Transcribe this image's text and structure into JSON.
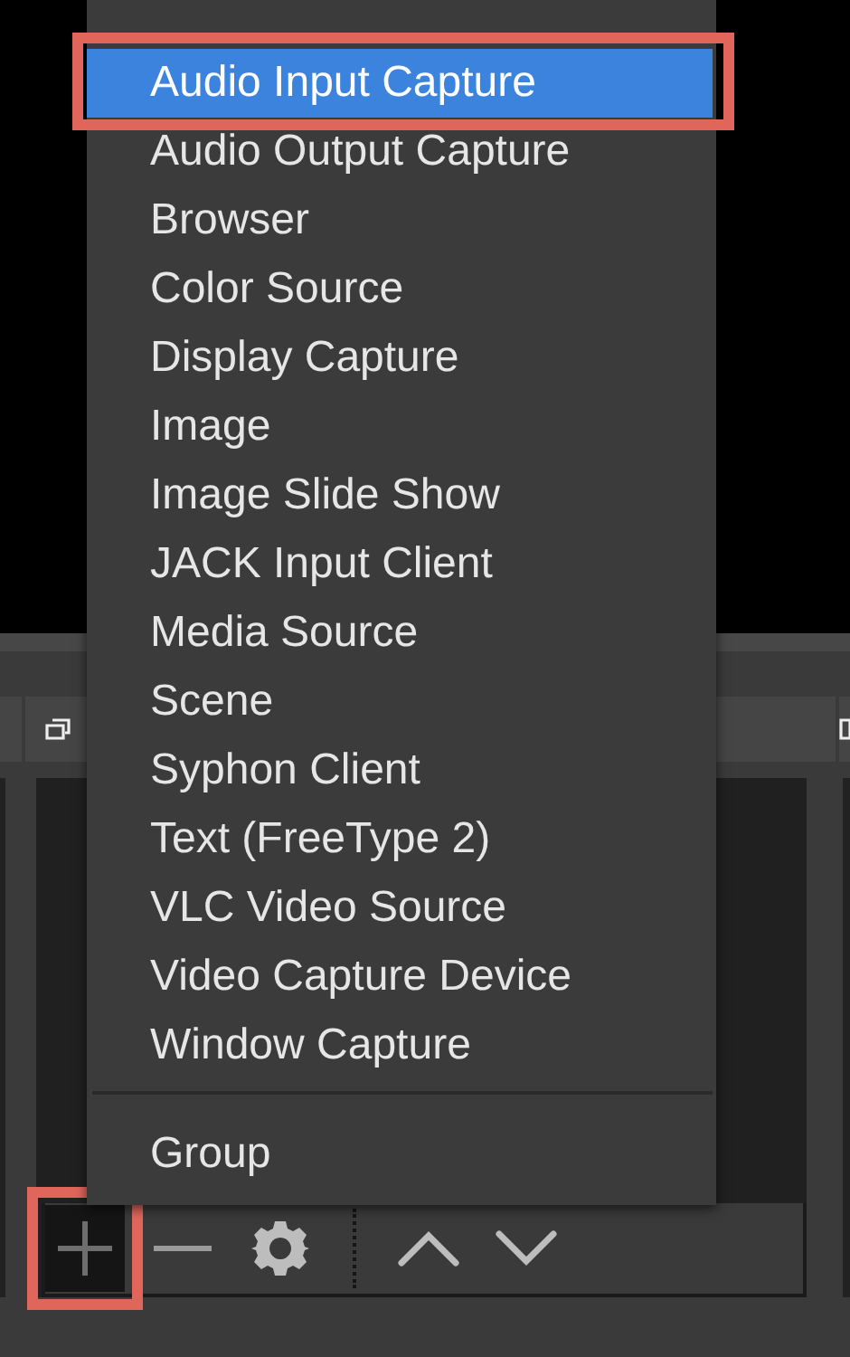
{
  "menu": {
    "items": [
      {
        "label": "Audio Input Capture",
        "selected": true,
        "outlined": true
      },
      {
        "label": "Audio Output Capture",
        "selected": false,
        "outlined": false
      },
      {
        "label": "Browser",
        "selected": false,
        "outlined": false
      },
      {
        "label": "Color Source",
        "selected": false,
        "outlined": false
      },
      {
        "label": "Display Capture",
        "selected": false,
        "outlined": false
      },
      {
        "label": "Image",
        "selected": false,
        "outlined": false
      },
      {
        "label": "Image Slide Show",
        "selected": false,
        "outlined": false
      },
      {
        "label": "JACK Input Client",
        "selected": false,
        "outlined": false
      },
      {
        "label": "Media Source",
        "selected": false,
        "outlined": false
      },
      {
        "label": "Scene",
        "selected": false,
        "outlined": false
      },
      {
        "label": "Syphon Client",
        "selected": false,
        "outlined": false
      },
      {
        "label": "Text (FreeType 2)",
        "selected": false,
        "outlined": false
      },
      {
        "label": "VLC Video Source",
        "selected": false,
        "outlined": false
      },
      {
        "label": "Video Capture Device",
        "selected": false,
        "outlined": false
      },
      {
        "label": "Window Capture",
        "selected": false,
        "outlined": false
      }
    ],
    "footer_items": [
      {
        "label": "Group",
        "selected": false,
        "outlined": false
      }
    ]
  },
  "toolbar": {
    "buttons": [
      {
        "kind": "add",
        "pressed": true,
        "outlined": true
      },
      {
        "kind": "remove",
        "pressed": false,
        "outlined": false
      },
      {
        "kind": "settings",
        "pressed": false,
        "outlined": false
      },
      {
        "kind": "up",
        "pressed": false,
        "outlined": false
      },
      {
        "kind": "down",
        "pressed": false,
        "outlined": false
      }
    ]
  }
}
